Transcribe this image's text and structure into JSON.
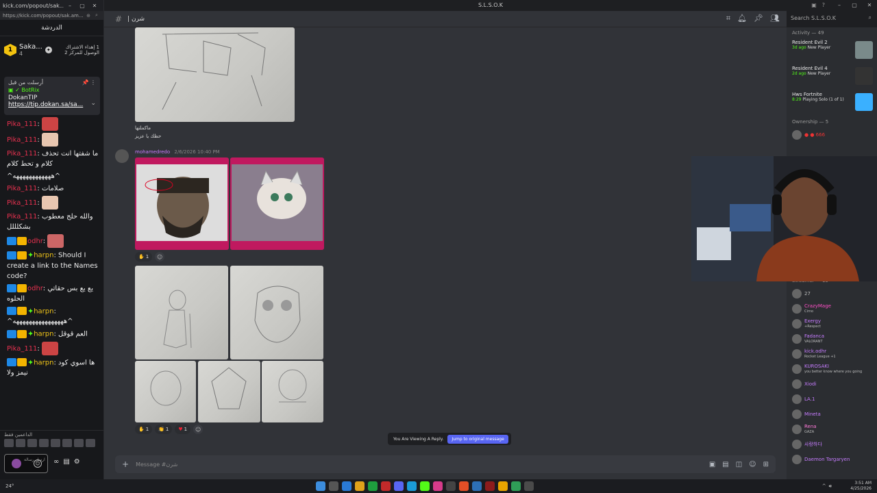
{
  "kick": {
    "window_title": "kick.com/popout/sak...",
    "url": "https://kick.com/popout/sak.am...",
    "chat_title": "الدردشة",
    "leader": {
      "rank": "1",
      "name": "Saka...",
      "count": "4",
      "info": "1 إهداء الاشتراك الوصول للمركز 2"
    },
    "pinned": {
      "header": "أرسلت من قبل",
      "bot_name": "BotRix",
      "name": "DokanTIP",
      "link": "https://tip.dokan.sa/sa..."
    },
    "messages": [
      {
        "user": "Pika_111",
        "text": ""
      },
      {
        "user": "Pika_111",
        "text": ""
      },
      {
        "user": "Pika_111",
        "text": "ما شفتها انت تحذف كلام و تحط كلام"
      },
      {
        "user": "",
        "text": "^ههههههههههههه^"
      },
      {
        "user": "Pika_111",
        "text": "صلامات"
      },
      {
        "user": "Pika_111",
        "text": ""
      },
      {
        "user": "Pika_111",
        "text": "والله حلج معطوب بشكلللل"
      },
      {
        "user": "odhr",
        "text": ""
      },
      {
        "user": "harpn",
        "text": "Should I create a link to the Names code?"
      },
      {
        "user": "odhr",
        "text": "يع يع بس حقاتي الحلوه"
      },
      {
        "user": "harpn",
        "text": "^ههههههههههههههههه^"
      },
      {
        "user": "harpn",
        "text": "العم قوقل"
      },
      {
        "user": "Pika_111",
        "text": ""
      },
      {
        "user": "harpn",
        "text": "ها اسوي كود نيمز ولا"
      }
    ],
    "footer_label": "الداعمين فقط",
    "input_placeholder": "ارسل رسالة"
  },
  "discord": {
    "window_title": "S.L.S.O.K",
    "channel": "شرن |",
    "search_placeholder": "Search S.L.S.O.K",
    "first_caption": "ماكملتها",
    "second_caption": "حظك يا عزيز",
    "author": "mohamedredo",
    "date": "2/6/2026 10:40 PM",
    "reaction1": "1",
    "reaction2a": "1",
    "reaction2b": "1",
    "reaction2c": "1",
    "reply_banner": "You Are Viewing A Reply.",
    "jump_button": "Jump to original message",
    "compose_placeholder": "Message #شرن",
    "activity_header": "Activity — 49",
    "activities": [
      {
        "game": "Resident Evil 2",
        "status": "3d ago",
        "note": "New Player"
      },
      {
        "game": "Resident Evil 4",
        "status": "2d ago",
        "note": "New Player"
      },
      {
        "game": "Hws Fortnite",
        "status": "8:29",
        "note": "Playing Solo (1 of 1)"
      }
    ],
    "ownership_header": "Ownership — 5",
    "streamer_header": "Streamer — 13",
    "members": [
      {
        "name": "27",
        "sub": ""
      },
      {
        "name": "CrazyMage",
        "sub": "Cirno"
      },
      {
        "name": "Exergy",
        "sub": "+Respect"
      },
      {
        "name": "Fadanca",
        "sub": "VALORANT"
      },
      {
        "name": "kick.odhr",
        "sub": "Rocket League +1"
      },
      {
        "name": "KUROSAKI",
        "sub": "you better know where you going"
      },
      {
        "name": "Xiodi",
        "sub": ""
      },
      {
        "name": "LA.1",
        "sub": ""
      },
      {
        "name": "Mineta",
        "sub": ""
      },
      {
        "name": "Rena",
        "sub": "GAZA"
      },
      {
        "name": "사랑하다",
        "sub": ""
      },
      {
        "name": "Daemon Targaryen",
        "sub": ""
      }
    ]
  },
  "taskbar": {
    "weather": "24°",
    "time": "3:51 AM",
    "date": "4/25/2026"
  }
}
